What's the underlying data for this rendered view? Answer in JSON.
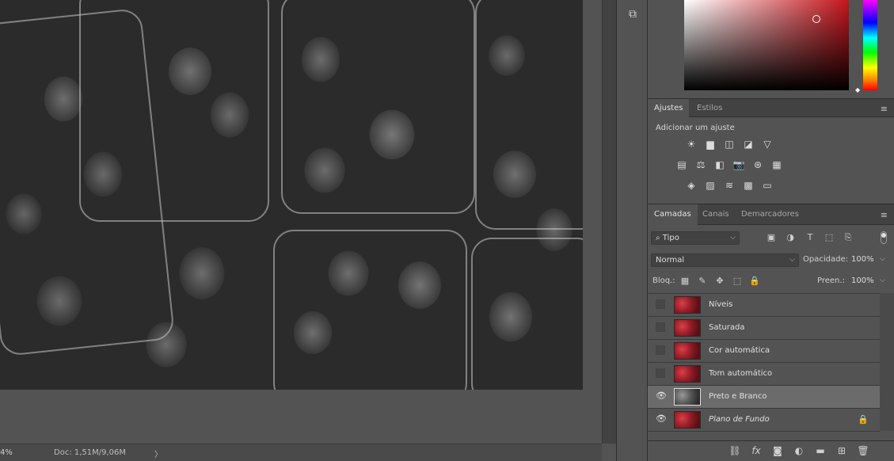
{
  "canvas": {
    "zoom": "4%",
    "doc_info": "Doc: 1,51M/9,06M",
    "status_arrow": "〉"
  },
  "dock": {
    "icon": "⧉"
  },
  "adjustments": {
    "tabs": [
      "Ajustes",
      "Estilos"
    ],
    "label": "Adicionar um ajuste",
    "icons_row1": [
      "☀",
      "▆",
      "◫",
      "◪",
      "▽"
    ],
    "icons_row2": [
      "▤",
      "⚖",
      "◧",
      "📷",
      "⊛",
      "▦"
    ],
    "icons_row3": [
      "◈",
      "▨",
      "≋",
      "▩",
      "▭"
    ]
  },
  "layers_panel": {
    "tabs": [
      "Camadas",
      "Canais",
      "Demarcadores"
    ],
    "filter_label": "Tipo",
    "filter_icon": "⌕",
    "blend_mode": "Normal",
    "opacity_label": "Opacidade:",
    "opacity_value": "100%",
    "lock_label": "Bloq.:",
    "fill_label": "Preen.:",
    "fill_value": "100%",
    "layers": [
      {
        "name": "Níveis",
        "visible": false,
        "selected": false,
        "italic": false
      },
      {
        "name": "Saturada",
        "visible": false,
        "selected": false,
        "italic": false
      },
      {
        "name": "Cor automática",
        "visible": false,
        "selected": false,
        "italic": false
      },
      {
        "name": "Tom automático",
        "visible": false,
        "selected": false,
        "italic": false
      },
      {
        "name": "Preto e Branco",
        "visible": true,
        "selected": true,
        "italic": false
      },
      {
        "name": "Plano de Fundo",
        "visible": true,
        "selected": false,
        "italic": true,
        "locked": true
      }
    ],
    "eye_glyph": "👁",
    "lock_glyph": "🔒",
    "footer_icons": [
      "⛓",
      "fx",
      "◙",
      "◐",
      "▬",
      "⊞",
      "🗑"
    ],
    "filter_icons": [
      "▣",
      "◑",
      "T",
      "⬚",
      "⎘"
    ],
    "lock_icons": [
      "▦",
      "✎",
      "✥",
      "⬚",
      "🔒"
    ]
  },
  "menu_glyph": "≡",
  "caret_glyph": "⌵"
}
